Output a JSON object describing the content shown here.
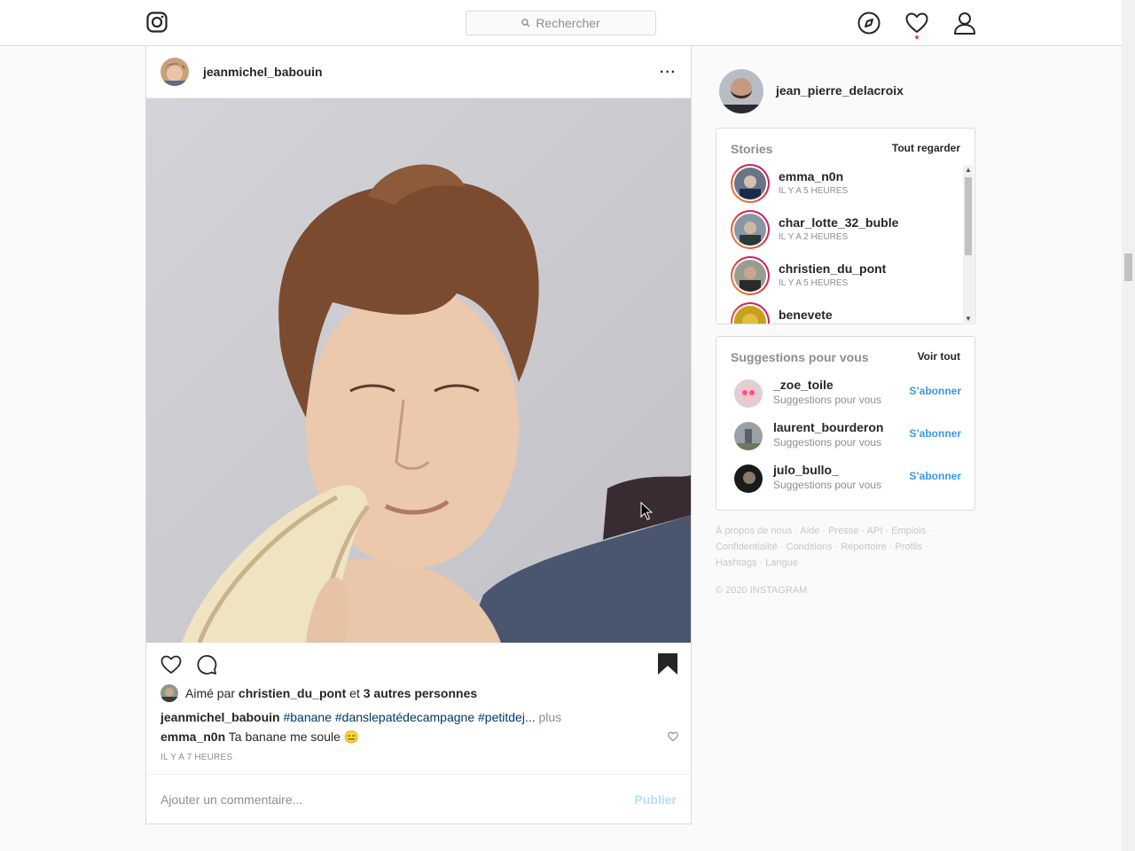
{
  "nav": {
    "search_placeholder": "Rechercher",
    "icons": [
      "instagram-logo-icon",
      "explore-compass-icon",
      "activity-heart-icon",
      "profile-icon"
    ]
  },
  "post": {
    "username": "jeanmichel_babouin",
    "more": "···",
    "liked_prefix": "Aimé par",
    "liked_user": "christien_du_pont",
    "liked_and": "et",
    "liked_others": "3 autres personnes",
    "caption_user": "jeanmichel_babouin",
    "caption_tags": "#banane #danslepatédecampagne #petitdej...",
    "caption_more": "plus",
    "comment_user": "emma_n0n",
    "comment_text": "Ta banane me soule 😑",
    "time": "IL Y A 7 HEURES",
    "comment_placeholder": "Ajouter un commentaire...",
    "publish": "Publier"
  },
  "sidebar": {
    "me": "jean_pierre_delacroix",
    "stories_title": "Stories",
    "stories_link": "Tout regarder",
    "stories": [
      {
        "name": "emma_n0n",
        "time": "IL Y A 5 HEURES"
      },
      {
        "name": "char_lotte_32_buble",
        "time": "IL Y A 2 HEURES"
      },
      {
        "name": "christien_du_pont",
        "time": "IL Y A 5 HEURES"
      },
      {
        "name": "benevete",
        "time": ""
      }
    ],
    "suggest_title": "Suggestions pour vous",
    "suggest_link": "Voir tout",
    "suggestions": [
      {
        "name": "_zoe_toile",
        "sub": "Suggestions pour vous",
        "action": "S’abonner"
      },
      {
        "name": "laurent_bourderon",
        "sub": "Suggestions pour vous",
        "action": "S’abonner"
      },
      {
        "name": "julo_bullo_",
        "sub": "Suggestions pour vous",
        "action": "S’abonner"
      }
    ],
    "footer_links": [
      "À propos de nous",
      "Aide",
      "Presse",
      "API",
      "Emplois",
      "Confidentialité",
      "Conditions",
      "Répertoire",
      "Profils",
      "Hashtags",
      "Langue"
    ],
    "copyright": "© 2020 INSTAGRAM"
  }
}
